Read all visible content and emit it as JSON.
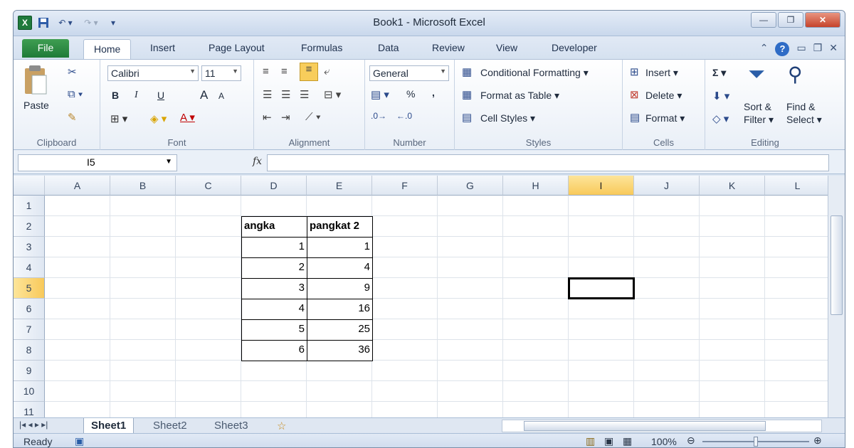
{
  "window": {
    "title": "Book1  -  Microsoft Excel"
  },
  "quick_access": {
    "excel_icon": "X",
    "save_icon": "save-icon",
    "undo": "↶ ▾",
    "redo": "↷ ▾",
    "customize": "▾"
  },
  "window_buttons": {
    "minimize": "—",
    "restore": "❐",
    "close": "✕"
  },
  "tabs": [
    "File",
    "Home",
    "Insert",
    "Page Layout",
    "Formulas",
    "Data",
    "Review",
    "View",
    "Developer"
  ],
  "ribbon": {
    "clipboard": {
      "label": "Clipboard",
      "paste": "Paste"
    },
    "font": {
      "label": "Font",
      "name": "Calibri",
      "size": "11",
      "bold": "B",
      "italic": "I",
      "underline": "U",
      "grow": "A",
      "shrink": "A"
    },
    "alignment": {
      "label": "Alignment"
    },
    "number": {
      "label": "Number",
      "format": "General",
      "percent": "%",
      "comma": ","
    },
    "styles": {
      "label": "Styles",
      "conditional": "Conditional Formatting ▾",
      "format_table": "Format as Table ▾",
      "cell_styles": "Cell Styles ▾"
    },
    "cells": {
      "label": "Cells",
      "insert": "Insert ▾",
      "delete": "Delete ▾",
      "format": "Format ▾"
    },
    "editing": {
      "label": "Editing",
      "sum": "Σ ▾",
      "sort": "Sort &",
      "filter": "Filter ▾",
      "find": "Find &",
      "select": "Select ▾"
    }
  },
  "formula_bar": {
    "name_box": "I5",
    "fx": "fx",
    "value": ""
  },
  "columns": [
    "A",
    "B",
    "C",
    "D",
    "E",
    "F",
    "G",
    "H",
    "I",
    "J",
    "K",
    "L"
  ],
  "rows": [
    "1",
    "2",
    "3",
    "4",
    "5",
    "6",
    "7",
    "8",
    "9",
    "10",
    "11"
  ],
  "table": {
    "header": [
      "angka",
      "pangkat 2"
    ],
    "rows": [
      [
        "1",
        "1"
      ],
      [
        "2",
        "4"
      ],
      [
        "3",
        "9"
      ],
      [
        "4",
        "16"
      ],
      [
        "5",
        "25"
      ],
      [
        "6",
        "36"
      ]
    ]
  },
  "selected": {
    "column": "I",
    "row": "5"
  },
  "sheets": [
    "Sheet1",
    "Sheet2",
    "Sheet3"
  ],
  "status": {
    "ready": "Ready",
    "zoom": "100%"
  }
}
